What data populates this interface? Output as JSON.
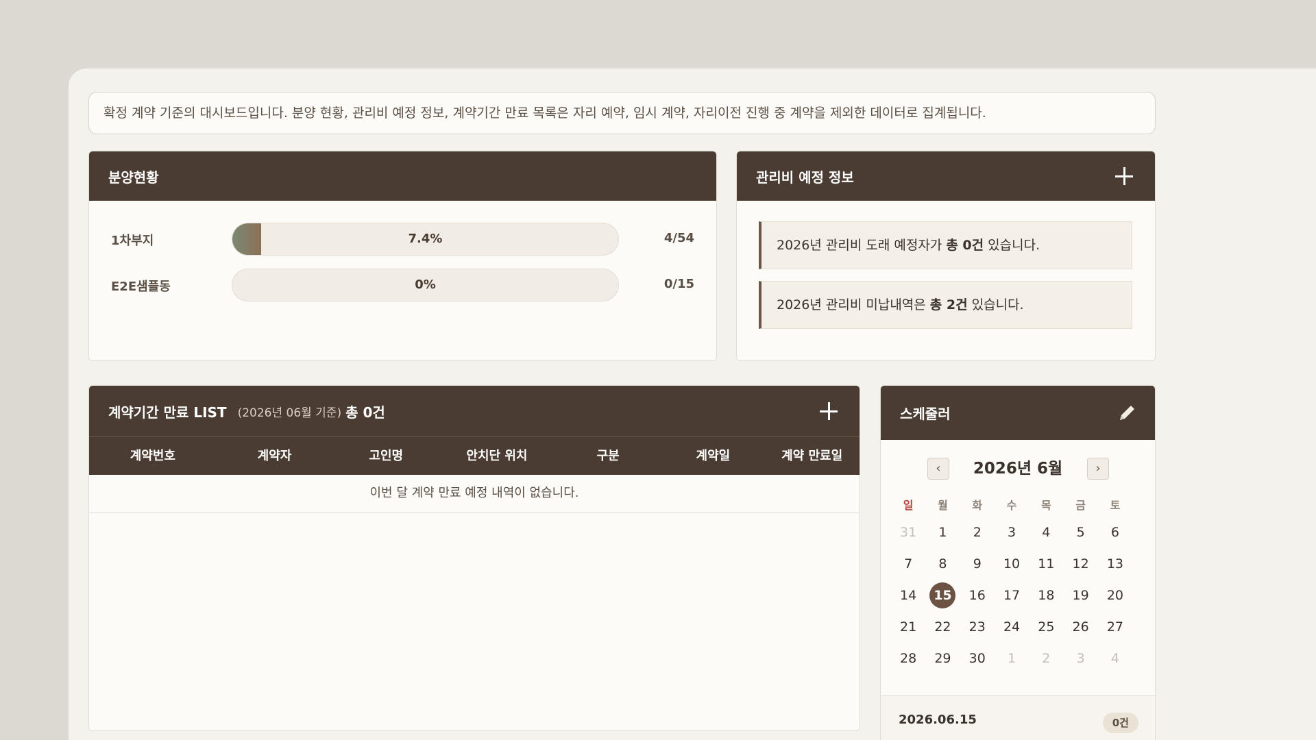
{
  "notice": "확정 계약 기준의 대시보드입니다. 분양 현황, 관리비 예정 정보, 계약기간 만료 목록은 자리 예약, 임시 계약, 자리이전 진행 중 계약을 제외한 데이터로 집계됩니다.",
  "sales": {
    "title": "분양현황",
    "rows": [
      {
        "name": "1차부지",
        "percent_label": "7.4%",
        "fraction": 0.074,
        "count": "4/54"
      },
      {
        "name": "E2E샘플동",
        "percent_label": "0%",
        "fraction": 0,
        "count": "0/15"
      }
    ]
  },
  "fee": {
    "title": "관리비 예정 정보",
    "items": [
      {
        "pre": "2026년 관리비 도래 예정자가 ",
        "bold": "총 0건",
        "post": " 있습니다."
      },
      {
        "pre": "2026년 관리비 미납내역은 ",
        "bold": "총 2건",
        "post": " 있습니다."
      }
    ]
  },
  "expire": {
    "title": "계약기간 만료 LIST",
    "basis": "(2026년 06월 기준)",
    "total": "총 0건",
    "columns": [
      "계약번호",
      "계약자",
      "고인명",
      "안치단 위치",
      "구분",
      "계약일",
      "계약 만료일"
    ],
    "empty_message": "이번 달 계약 만료 예정 내역이 없습니다."
  },
  "scheduler": {
    "title": "스케줄러",
    "month_label": "2026년 6월",
    "prev": "‹",
    "next": "›",
    "weekdays": [
      "일",
      "월",
      "화",
      "수",
      "목",
      "금",
      "토"
    ],
    "weeks": [
      [
        {
          "d": "31",
          "o": true
        },
        {
          "d": "1"
        },
        {
          "d": "2"
        },
        {
          "d": "3"
        },
        {
          "d": "4"
        },
        {
          "d": "5"
        },
        {
          "d": "6"
        }
      ],
      [
        {
          "d": "7"
        },
        {
          "d": "8"
        },
        {
          "d": "9"
        },
        {
          "d": "10"
        },
        {
          "d": "11"
        },
        {
          "d": "12"
        },
        {
          "d": "13"
        }
      ],
      [
        {
          "d": "14"
        },
        {
          "d": "15",
          "t": true
        },
        {
          "d": "16"
        },
        {
          "d": "17"
        },
        {
          "d": "18"
        },
        {
          "d": "19"
        },
        {
          "d": "20"
        }
      ],
      [
        {
          "d": "21"
        },
        {
          "d": "22"
        },
        {
          "d": "23"
        },
        {
          "d": "24"
        },
        {
          "d": "25"
        },
        {
          "d": "26"
        },
        {
          "d": "27"
        }
      ],
      [
        {
          "d": "28"
        },
        {
          "d": "29"
        },
        {
          "d": "30"
        },
        {
          "d": "1",
          "o": true
        },
        {
          "d": "2",
          "o": true
        },
        {
          "d": "3",
          "o": true
        },
        {
          "d": "4",
          "o": true
        }
      ]
    ],
    "selected_date": "2026.06.15",
    "selected_count": "0건"
  },
  "icons": {
    "add": "plus-icon",
    "edit": "pencil-icon"
  },
  "colors": {
    "header": "#4a3c32",
    "accent": "#6b5242",
    "sunday": "#b2443a"
  }
}
